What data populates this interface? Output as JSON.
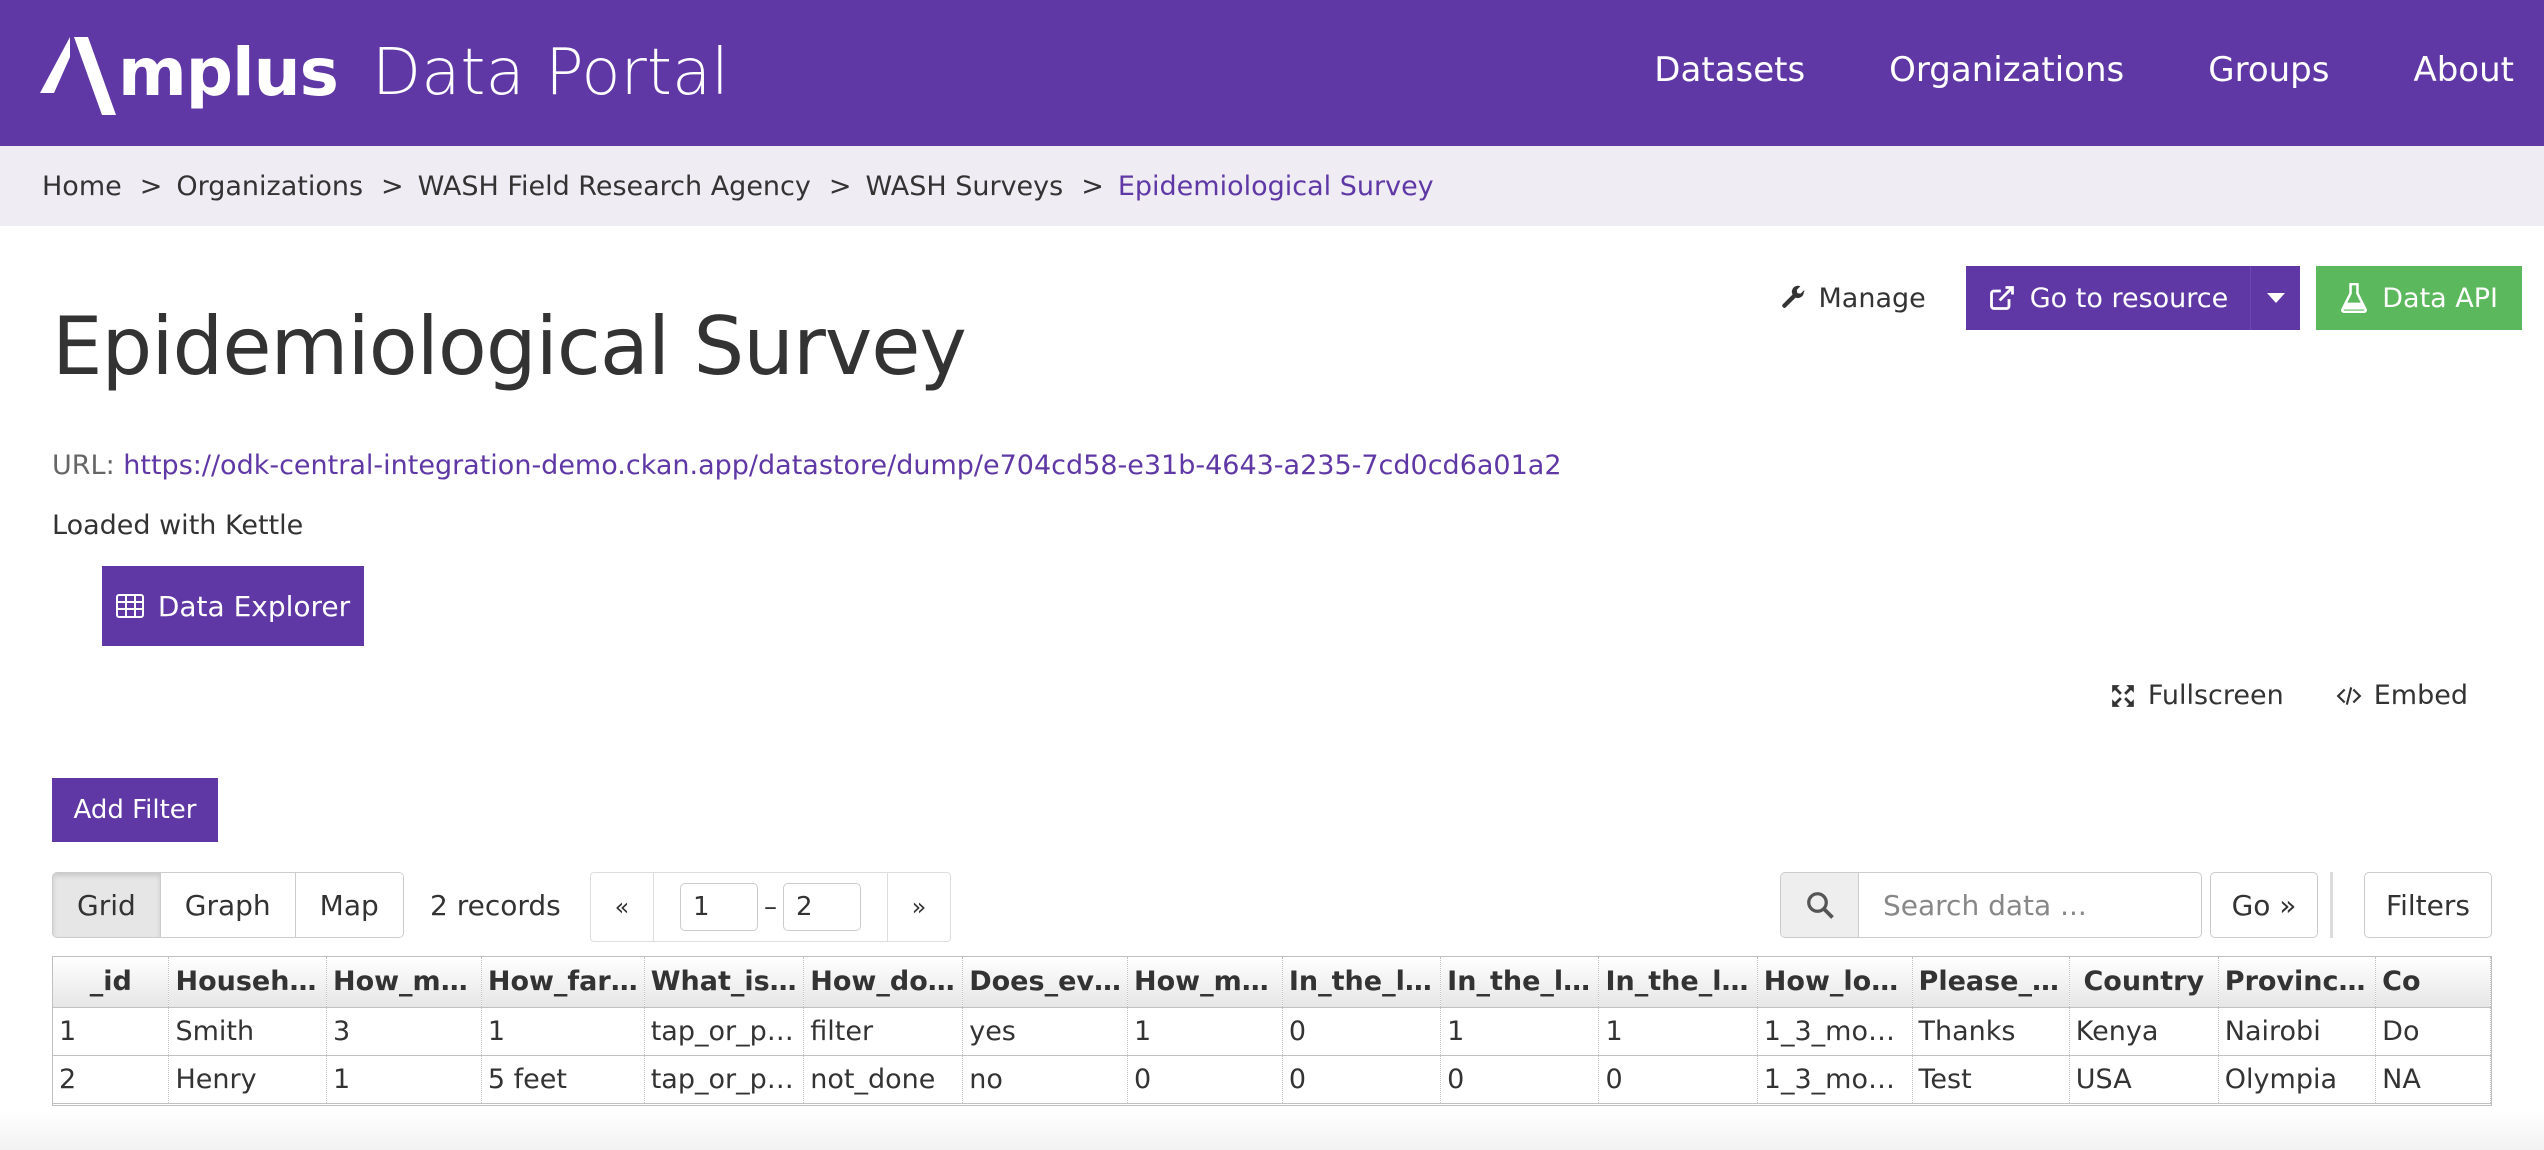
{
  "header": {
    "logo_word": "mplus",
    "portal_title": "Data Portal",
    "nav": [
      "Datasets",
      "Organizations",
      "Groups",
      "About"
    ],
    "bg_color": "#5f38a5"
  },
  "breadcrumb": {
    "items": [
      "Home",
      "Organizations",
      "WASH Field Research Agency",
      "WASH Surveys"
    ],
    "separator": ">",
    "active": "Epidemiological Survey"
  },
  "actions": {
    "manage": "Manage",
    "go_to_resource": "Go to resource",
    "data_api": "Data API"
  },
  "resource": {
    "title": "Epidemiological Survey",
    "url_label": "URL:",
    "url": "https://odk-central-integration-demo.ckan.app/datastore/dump/e704cd58-e31b-4643-a235-7cd0cd6a01a2",
    "loaded_with": "Loaded with Kettle",
    "explorer_button": "Data Explorer"
  },
  "view_links": {
    "fullscreen": "Fullscreen",
    "embed": "Embed"
  },
  "toolbar": {
    "add_filter": "Add Filter",
    "views": [
      "Grid",
      "Graph",
      "Map"
    ],
    "active_view": "Grid",
    "records": "2 records",
    "prev": "«",
    "next": "»",
    "from": "1",
    "range_sep": "–",
    "to": "2",
    "search_placeholder": "Search data ...",
    "go": "Go »",
    "filters": "Filters"
  },
  "grid": {
    "columns": [
      "_id",
      "Househ…",
      "How_m…",
      "How_far…",
      "What_is…",
      "How_do…",
      "Does_ev…",
      "How_m…",
      "In_the_l…",
      "In_the_l…",
      "In_the_l…",
      "How_lo…",
      "Please_…",
      "Country",
      "Provinc…",
      "Co"
    ],
    "rows": [
      [
        "1",
        "Smith",
        "3",
        "1",
        "tap_or_p…",
        "filter",
        "yes",
        "1",
        "0",
        "1",
        "1",
        "1_3_mo…",
        "Thanks",
        "Kenya",
        "Nairobi",
        "Do"
      ],
      [
        "2",
        "Henry",
        "1",
        "5 feet",
        "tap_or_p…",
        "not_done",
        "no",
        "0",
        "0",
        "0",
        "0",
        "1_3_mo…",
        "Test",
        "USA",
        "Olympia",
        "NA"
      ]
    ]
  }
}
